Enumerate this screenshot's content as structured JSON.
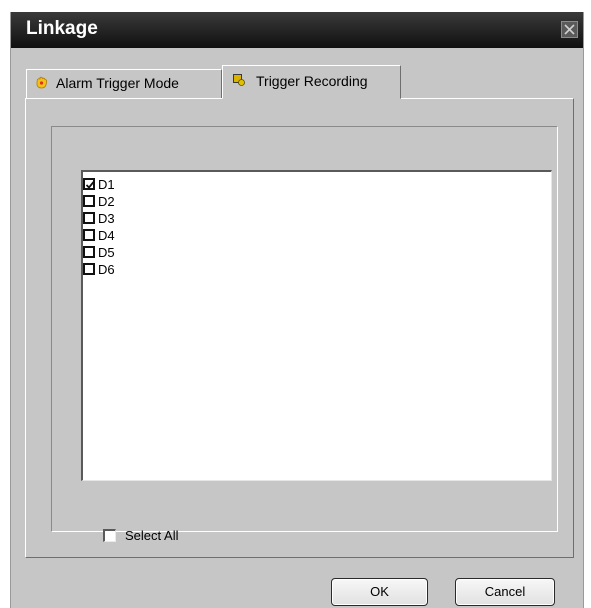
{
  "window": {
    "title": "Linkage",
    "close_icon": "close-icon"
  },
  "tabs": [
    {
      "label": "Alarm Trigger Mode",
      "icon": "alarm-hand-icon",
      "selected": false
    },
    {
      "label": "Trigger Recording",
      "icon": "record-icon",
      "selected": true
    }
  ],
  "channels": [
    {
      "label": "D1",
      "checked": true
    },
    {
      "label": "D2",
      "checked": false
    },
    {
      "label": "D3",
      "checked": false
    },
    {
      "label": "D4",
      "checked": false
    },
    {
      "label": "D5",
      "checked": false
    },
    {
      "label": "D6",
      "checked": false
    }
  ],
  "select_all": {
    "label": "Select All",
    "checked": false
  },
  "buttons": {
    "ok": "OK",
    "cancel": "Cancel"
  },
  "colors": {
    "dialog_bg": "#c6c6c6",
    "titlebar_bg": "#1e1e1e",
    "title_text": "#ffffff",
    "tab1_icon": "#f2c21a",
    "tab2_icon": "#d8b400"
  }
}
